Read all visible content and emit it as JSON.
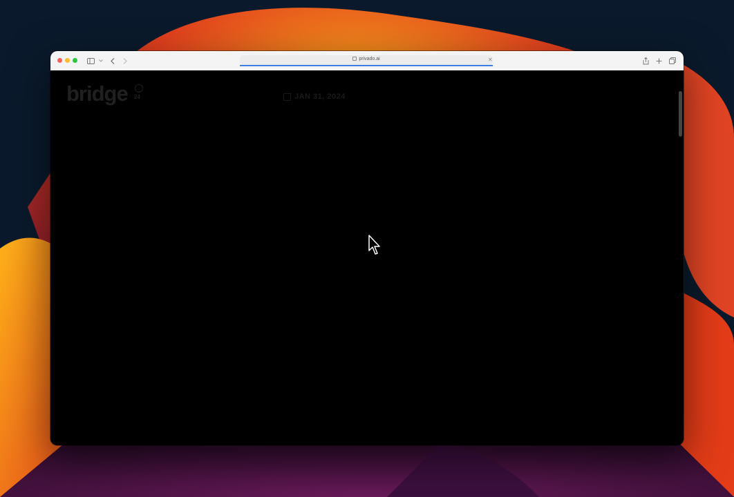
{
  "browser": {
    "url": "privado.ai",
    "load_progress_percent": 100
  },
  "page": {
    "logo_text": "bridge",
    "logo_suffix": "24",
    "date_text": "JAN 31, 2024"
  },
  "colors": {
    "page_background": "#000000",
    "progress_bar": "#3b7ee8",
    "close": "#fe5f57",
    "minimize": "#febc2e",
    "maximize": "#28c840"
  },
  "icons": [
    "sidebar-icon",
    "chevron-down-icon",
    "back-icon",
    "forward-icon",
    "lock-icon",
    "clear-icon",
    "share-icon",
    "new-tab-icon",
    "tab-overview-icon",
    "calendar-icon",
    "cursor-icon"
  ]
}
